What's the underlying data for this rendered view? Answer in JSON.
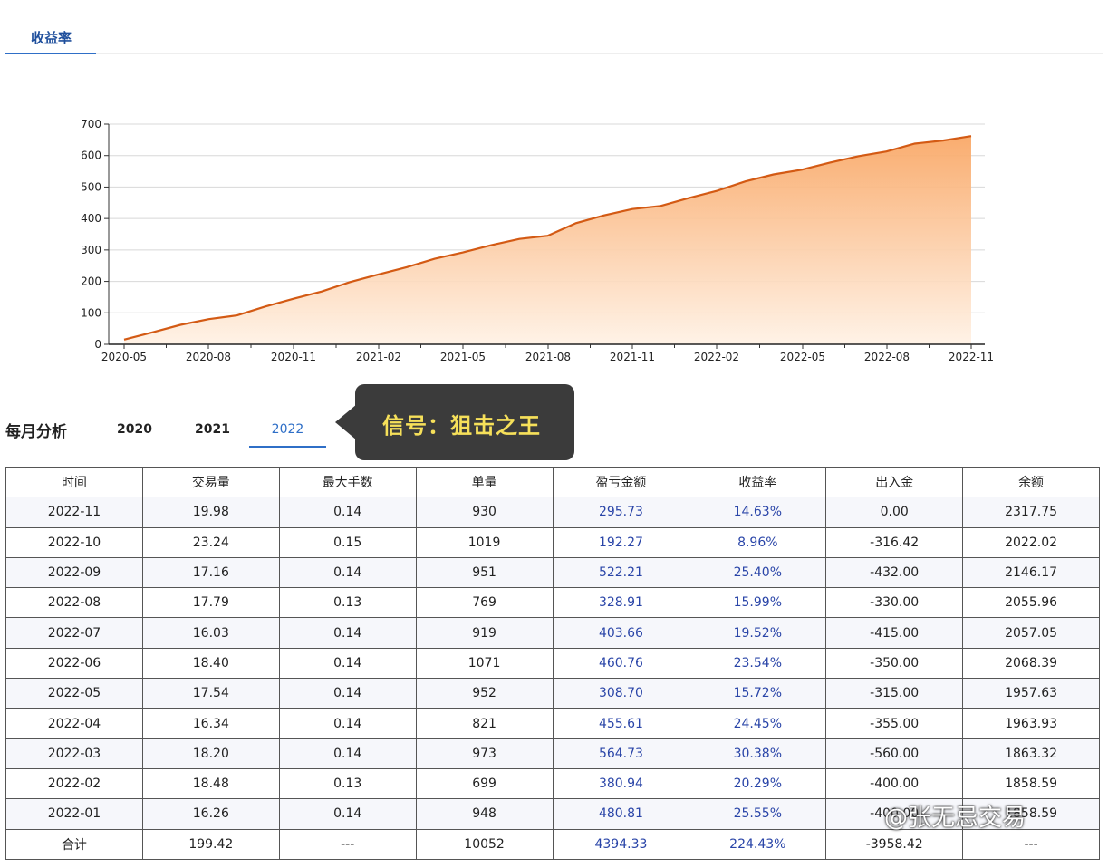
{
  "tabs": {
    "active": "收益率"
  },
  "chart_data": {
    "type": "area",
    "title": "",
    "xlabel": "",
    "ylabel": "",
    "ylim": [
      0,
      700
    ],
    "yticks": [
      0,
      100,
      200,
      300,
      400,
      500,
      600,
      700
    ],
    "xtick_labels": [
      "2020-05",
      "2020-08",
      "2020-11",
      "2021-02",
      "2021-05",
      "2021-08",
      "2021-11",
      "2022-02",
      "2022-05",
      "2022-08",
      "2022-11"
    ],
    "grid": true,
    "legend": "none",
    "series": [
      {
        "x": [
          "2020-05",
          "2020-06",
          "2020-07",
          "2020-08",
          "2020-09",
          "2020-10",
          "2020-11",
          "2020-12",
          "2021-01",
          "2021-02",
          "2021-03",
          "2021-04",
          "2021-05",
          "2021-06",
          "2021-07",
          "2021-08",
          "2021-09",
          "2021-10",
          "2021-11",
          "2021-12",
          "2022-01",
          "2022-02",
          "2022-03",
          "2022-04",
          "2022-05",
          "2022-06",
          "2022-07",
          "2022-08",
          "2022-09",
          "2022-10",
          "2022-11"
        ],
        "values": [
          15,
          38,
          62,
          80,
          92,
          120,
          145,
          168,
          198,
          222,
          245,
          272,
          292,
          315,
          335,
          345,
          385,
          410,
          430,
          440,
          465,
          488,
          518,
          540,
          555,
          578,
          598,
          613,
          638,
          648,
          662
        ]
      }
    ],
    "colors": {
      "line": "#d35a14",
      "fill_top": "#f9a867",
      "fill_bottom": "#fff1e4"
    }
  },
  "monthly": {
    "title": "每月分析",
    "years": [
      "2020",
      "2021",
      "2022"
    ],
    "active_year": "2022",
    "columns": [
      "时间",
      "交易量",
      "最大手数",
      "单量",
      "盈亏金额",
      "收益率",
      "出入金",
      "余额"
    ],
    "rows": [
      [
        "2022-11",
        "19.98",
        "0.14",
        "930",
        "295.73",
        "14.63%",
        "0.00",
        "2317.75"
      ],
      [
        "2022-10",
        "23.24",
        "0.15",
        "1019",
        "192.27",
        "8.96%",
        "-316.42",
        "2022.02"
      ],
      [
        "2022-09",
        "17.16",
        "0.14",
        "951",
        "522.21",
        "25.40%",
        "-432.00",
        "2146.17"
      ],
      [
        "2022-08",
        "17.79",
        "0.13",
        "769",
        "328.91",
        "15.99%",
        "-330.00",
        "2055.96"
      ],
      [
        "2022-07",
        "16.03",
        "0.14",
        "919",
        "403.66",
        "19.52%",
        "-415.00",
        "2057.05"
      ],
      [
        "2022-06",
        "18.40",
        "0.14",
        "1071",
        "460.76",
        "23.54%",
        "-350.00",
        "2068.39"
      ],
      [
        "2022-05",
        "17.54",
        "0.14",
        "952",
        "308.70",
        "15.72%",
        "-315.00",
        "1957.63"
      ],
      [
        "2022-04",
        "16.34",
        "0.14",
        "821",
        "455.61",
        "24.45%",
        "-355.00",
        "1963.93"
      ],
      [
        "2022-03",
        "18.20",
        "0.14",
        "973",
        "564.73",
        "30.38%",
        "-560.00",
        "1863.32"
      ],
      [
        "2022-02",
        "18.48",
        "0.13",
        "699",
        "380.94",
        "20.29%",
        "-400.00",
        "1858.59"
      ],
      [
        "2022-01",
        "16.26",
        "0.14",
        "948",
        "480.81",
        "25.55%",
        "-400.00",
        "1858.59"
      ]
    ],
    "total": [
      "合计",
      "199.42",
      "---",
      "10052",
      "4394.33",
      "224.43%",
      "-3958.42",
      "---"
    ]
  },
  "overlay": {
    "text": "信号：狙击之王"
  },
  "watermark": {
    "text": "@张无忌交易"
  }
}
